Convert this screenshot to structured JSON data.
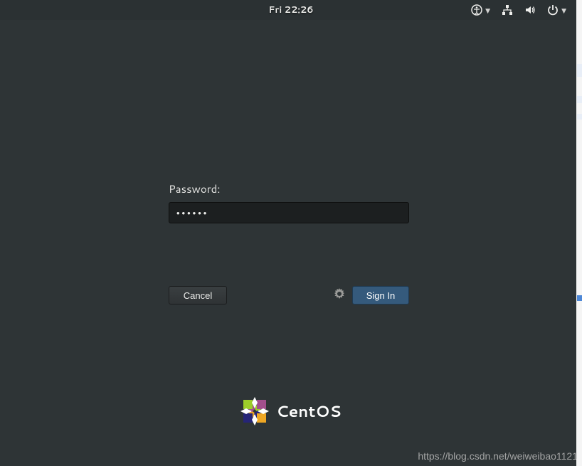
{
  "topbar": {
    "datetime": "Fri 22:26"
  },
  "login": {
    "password_label": "Password:",
    "password_value": "••••••",
    "cancel_label": "Cancel",
    "signin_label": "Sign In"
  },
  "branding": {
    "os_name": "CentOS"
  },
  "watermark": {
    "text": "https://blog.csdn.net/weiweibao1121"
  }
}
